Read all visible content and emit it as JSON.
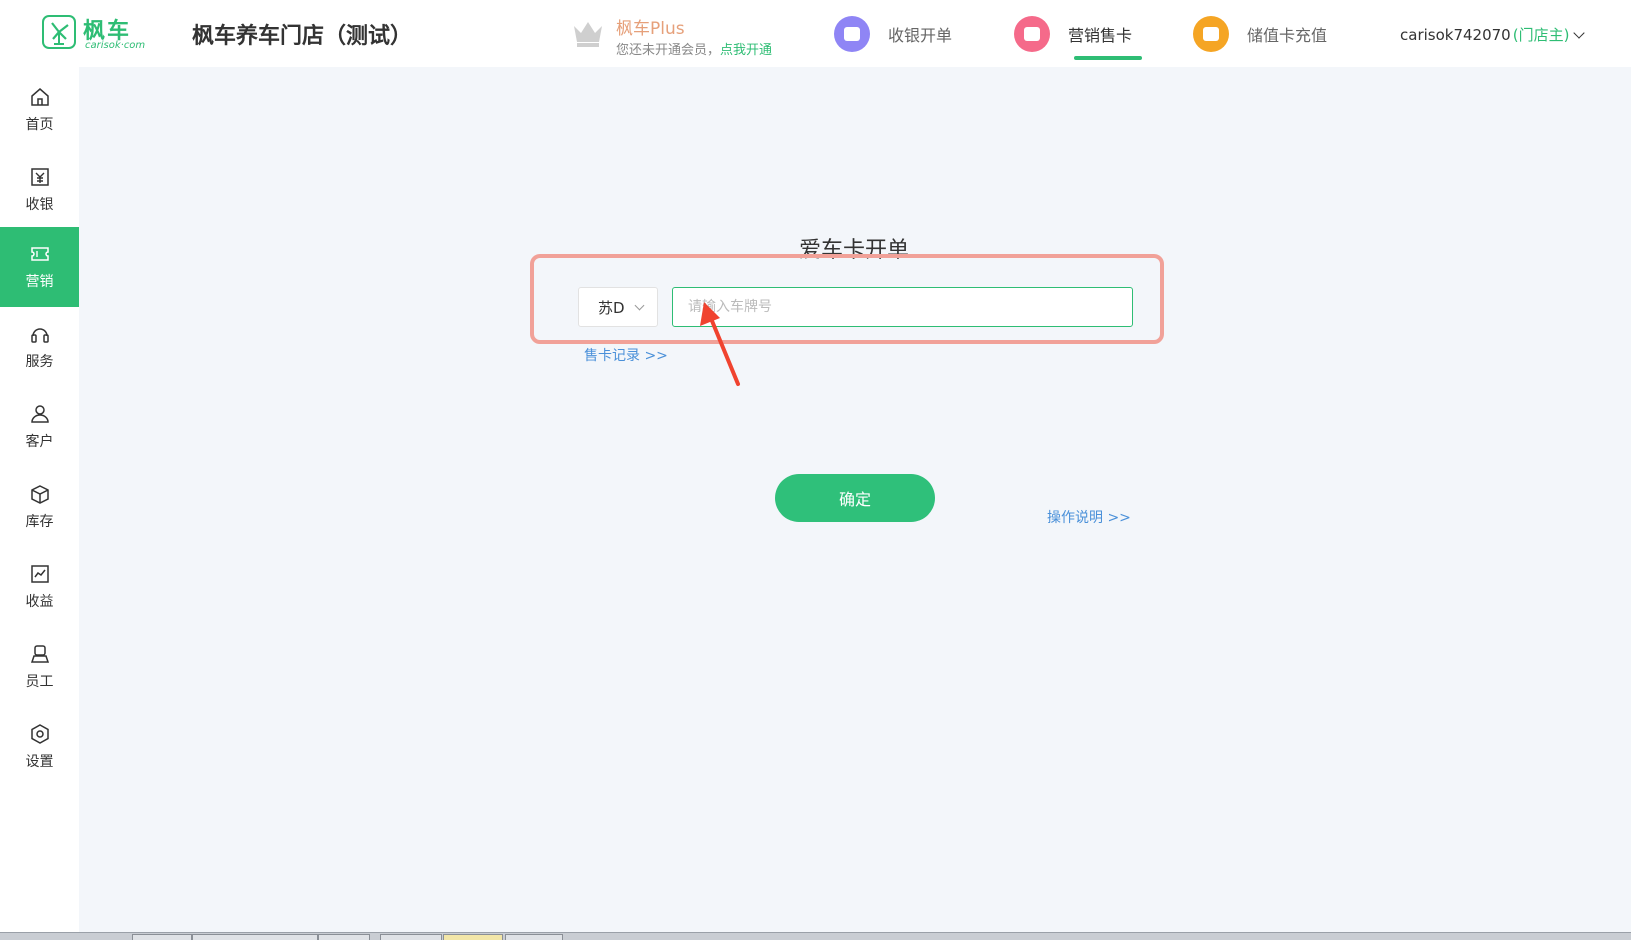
{
  "header": {
    "logo_cn": "枫车",
    "logo_en": "carisok·com",
    "shop_title": "枫车养车门店（测试）",
    "plus": {
      "title": "枫车Plus",
      "desc": "您还未开通会员，",
      "link": "点我开通"
    },
    "nav": [
      {
        "label": "收银开单",
        "icon": "receipt-icon",
        "color": "#8f85f5"
      },
      {
        "label": "营销售卡",
        "icon": "card-icon",
        "color": "#f56a8a"
      },
      {
        "label": "储值卡充值",
        "icon": "wallet-icon",
        "color": "#f5a524"
      }
    ],
    "active_nav": "营销售卡",
    "user": {
      "name": "carisok742070",
      "role": "(门店主)"
    }
  },
  "sidebar": {
    "items": [
      {
        "label": "首页",
        "icon": "home-icon"
      },
      {
        "label": "收银",
        "icon": "cashier-icon"
      },
      {
        "label": "营销",
        "icon": "ticket-icon"
      },
      {
        "label": "服务",
        "icon": "headset-icon"
      },
      {
        "label": "客户",
        "icon": "user-icon"
      },
      {
        "label": "库存",
        "icon": "box-icon"
      },
      {
        "label": "收益",
        "icon": "chart-icon"
      },
      {
        "label": "员工",
        "icon": "staff-icon"
      },
      {
        "label": "设置",
        "icon": "settings-icon"
      }
    ],
    "active": "营销"
  },
  "main": {
    "title": "爱车卡开单",
    "province": "苏D",
    "plate_placeholder": "请输入车牌号",
    "sales_record_link": "售卡记录 >>",
    "confirm_label": "确定",
    "instructions_link": "操作说明 >>"
  },
  "colors": {
    "brand_green": "#2ebd74",
    "highlight": "#f1a198",
    "arrow": "#f0432f",
    "link": "#4a90d9"
  }
}
